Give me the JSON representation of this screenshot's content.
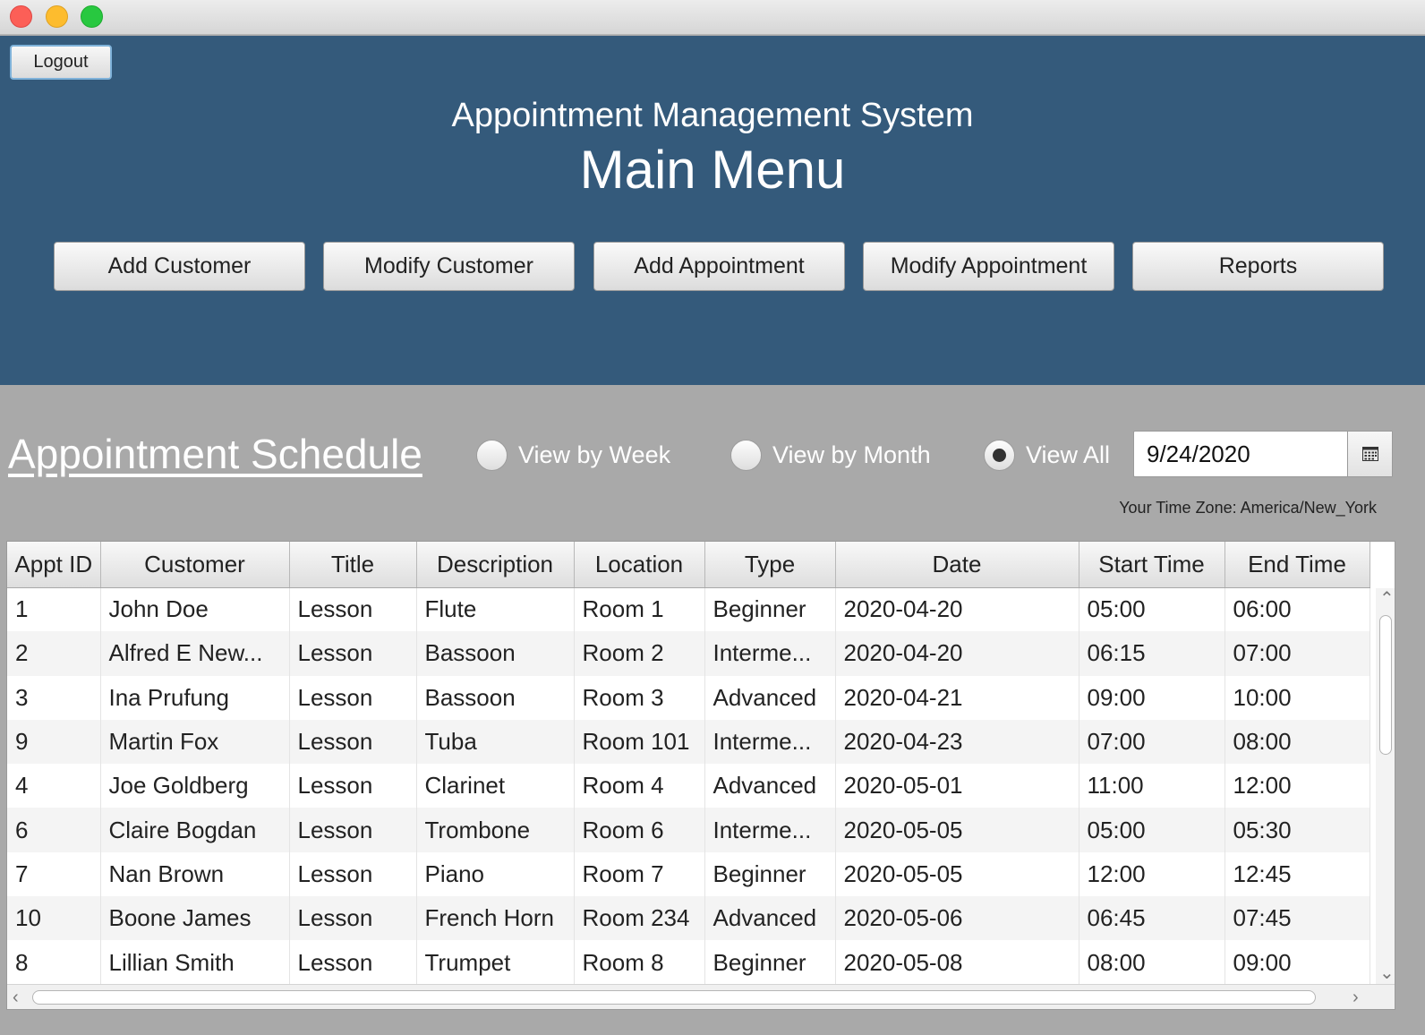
{
  "header": {
    "logout_label": "Logout",
    "app_title": "Appointment Management System",
    "page_title": "Main Menu",
    "buttons": [
      "Add Customer",
      "Modify Customer",
      "Add Appointment",
      "Modify Appointment",
      "Reports"
    ]
  },
  "schedule": {
    "title": "Appointment Schedule",
    "view_options": [
      "View by Week",
      "View by Month",
      "View All"
    ],
    "selected_view": "View All",
    "date_value": "9/24/2020",
    "calendar_icon": "calendar-icon",
    "timezone_text": "Your Time Zone: America/New_York"
  },
  "table": {
    "columns": [
      "Appt ID",
      "Customer",
      "Title",
      "Description",
      "Location",
      "Type",
      "Date",
      "Start Time",
      "End Time"
    ],
    "rows": [
      [
        "1",
        "John Doe",
        "Lesson",
        "Flute",
        "Room 1",
        "Beginner",
        "2020-04-20",
        "05:00",
        "06:00"
      ],
      [
        "2",
        "Alfred E New...",
        "Lesson",
        "Bassoon",
        "Room 2",
        "Interme...",
        "2020-04-20",
        "06:15",
        "07:00"
      ],
      [
        "3",
        "Ina Prufung",
        "Lesson",
        "Bassoon",
        "Room 3",
        "Advanced",
        "2020-04-21",
        "09:00",
        "10:00"
      ],
      [
        "9",
        "Martin Fox",
        "Lesson",
        "Tuba",
        "Room 101",
        "Interme...",
        "2020-04-23",
        "07:00",
        "08:00"
      ],
      [
        "4",
        "Joe Goldberg",
        "Lesson",
        "Clarinet",
        "Room 4",
        "Advanced",
        "2020-05-01",
        "11:00",
        "12:00"
      ],
      [
        "6",
        "Claire Bogdan",
        "Lesson",
        "Trombone",
        "Room 6",
        "Interme...",
        "2020-05-05",
        "05:00",
        "05:30"
      ],
      [
        "7",
        "Nan Brown",
        "Lesson",
        "Piano",
        "Room 7",
        "Beginner",
        "2020-05-05",
        "12:00",
        "12:45"
      ],
      [
        "10",
        "Boone James",
        "Lesson",
        "French Horn",
        "Room 234",
        "Advanced",
        "2020-05-06",
        "06:45",
        "07:45"
      ],
      [
        "8",
        "Lillian Smith",
        "Lesson",
        "Trumpet",
        "Room 8",
        "Beginner",
        "2020-05-08",
        "08:00",
        "09:00"
      ]
    ]
  }
}
